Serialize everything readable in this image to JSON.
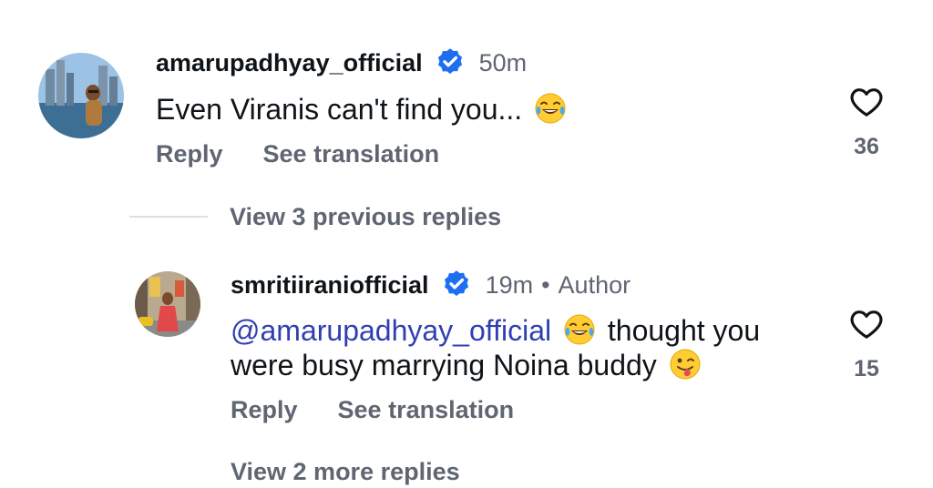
{
  "comments": [
    {
      "username": "amarupadhyay_official",
      "verified": true,
      "time": "50m",
      "text": "Even Viranis can't find you...",
      "emoji": "face-with-tears-of-joy",
      "reply_label": "Reply",
      "translate_label": "See translation",
      "likes": "36"
    }
  ],
  "previous_replies_label": "View 3 previous replies",
  "reply": {
    "username": "smritiiraniofficial",
    "verified": true,
    "time": "19m",
    "separator": "•",
    "author_label": "Author",
    "mention": "@amarupadhyay_official",
    "text_part1": "thought you",
    "text_part2": "were busy marrying Noina buddy",
    "emojis": [
      "face-with-tears-of-joy",
      "winking-face-with-tongue"
    ],
    "reply_label": "Reply",
    "translate_label": "See translation",
    "likes": "15"
  },
  "more_replies_label": "View 2 more replies",
  "colors": {
    "verified_blue": "#1d6ff2",
    "mention_blue": "#2f3fb2",
    "secondary_text": "#5f6672"
  }
}
